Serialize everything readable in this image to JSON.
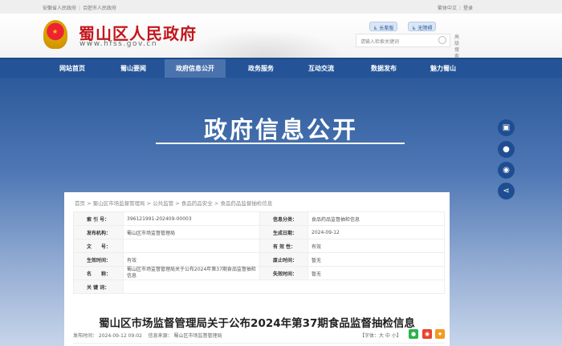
{
  "topbar": {
    "links": [
      "安徽省人民政府",
      "合肥市人民政府"
    ],
    "right": [
      "繁体中文",
      "登录"
    ]
  },
  "header": {
    "site_name": "蜀山区人民政府",
    "url": "www.hfss.gov.cn",
    "elder": "长辈版",
    "accessible": "无障碍",
    "search_placeholder": "请输入检索关键词",
    "advanced": "高级搜索"
  },
  "nav": [
    "网站首页",
    "蜀山要闻",
    "政府信息公开",
    "政务服务",
    "互动交流",
    "数据发布",
    "魅力蜀山"
  ],
  "banner": {
    "title": "政府信息公开"
  },
  "breadcrumb": [
    "首页",
    "蜀山区市场监督管理局",
    "公共监管",
    "食品药品安全",
    "食品药品监督抽检信息"
  ],
  "info": [
    {
      "k1": "索 引 号：",
      "v1": "396121991-202409-00003",
      "k2": "信息分类：",
      "v2": "食品药品监督抽检信息"
    },
    {
      "k1": "发布机构：",
      "v1": "蜀山区市场监督管理局",
      "k2": "生成日期：",
      "v2": "2024-09-12"
    },
    {
      "k1": "文　　号：",
      "v1": "",
      "k2": "有 效 性：",
      "v2": "有效"
    },
    {
      "k1": "生效时间：",
      "v1": "有效",
      "k2": "废止时间：",
      "v2": "暂无"
    },
    {
      "k1": "名　　称：",
      "v1": "蜀山区市场监督管理局关于公布2024年第37期食品监督抽检信息",
      "k2": "失效时间：",
      "v2": "暂无"
    }
  ],
  "keywords_label": "关 键 词：",
  "article": {
    "title": "蜀山区市场监督管理局关于公布2024年第37期食品监督抽检信息",
    "publish": "发布时间： 2024-09-12 09:02",
    "source": "信息来源： 蜀山区市场监督管理局",
    "font_size": "【字体：大 中 小】"
  },
  "colors": {
    "nav": "#245497",
    "title_red": "#c4161c"
  }
}
